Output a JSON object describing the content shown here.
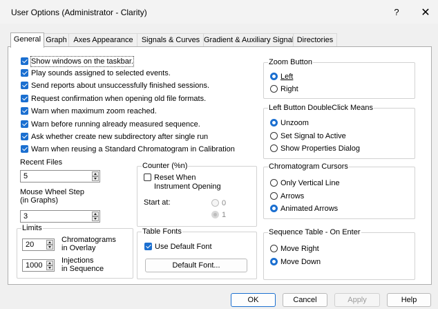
{
  "window": {
    "title": "User Options (Administrator - Clarity)",
    "help": "?",
    "close": "✕"
  },
  "tabs": [
    "General",
    "Graph",
    "Axes Appearance",
    "Signals & Curves",
    "Gradient & Auxiliary Signals",
    "Directories"
  ],
  "checkboxes": [
    {
      "label": "Show windows on the taskbar.",
      "checked": true
    },
    {
      "label": "Play sounds assigned to selected events.",
      "checked": true
    },
    {
      "label": "Send reports about unsuccessfully finished sessions.",
      "checked": true
    },
    {
      "label": "Request confirmation when opening old file formats.",
      "checked": true
    },
    {
      "label": "Warn when maximum zoom reached.",
      "checked": true
    },
    {
      "label": "Warn before running already measured sequence.",
      "checked": true
    },
    {
      "label": "Ask whether create new subdirectory after single run",
      "checked": true
    },
    {
      "label": "Warn when reusing a Standard Chromatogram in Calibration",
      "checked": true
    }
  ],
  "recent_files": {
    "label": "Recent Files",
    "value": "5"
  },
  "mouse_wheel": {
    "label_1": "Mouse Wheel Step",
    "label_2": "(in Graphs)",
    "value": "3"
  },
  "limits": {
    "title": "Limits",
    "chromatograms": {
      "value": "20",
      "label_1": "Chromatograms",
      "label_2": "in Overlay"
    },
    "injections": {
      "value": "1000",
      "label_1": "Injections",
      "label_2": "in Sequence"
    }
  },
  "counter": {
    "title": "Counter (%n)",
    "reset_label_1": "Reset When",
    "reset_label_2": "Instrument Opening",
    "reset_checked": false,
    "start_at_label": "Start at:",
    "options": [
      "0",
      "1"
    ],
    "selected": "1"
  },
  "table_fonts": {
    "title": "Table Fonts",
    "use_default_label": "Use Default Font",
    "use_default_checked": true,
    "button": "Default Font..."
  },
  "zoom_button": {
    "title": "Zoom Button",
    "options": [
      "Left",
      "Right"
    ],
    "selected": "Left"
  },
  "left_dblclick": {
    "title": "Left Button DoubleClick Means",
    "options": [
      "Unzoom",
      "Set Signal to Active",
      "Show Properties Dialog"
    ],
    "selected": "Unzoom"
  },
  "cursors": {
    "title": "Chromatogram Cursors",
    "options": [
      "Only Vertical Line",
      "Arrows",
      "Animated Arrows"
    ],
    "selected": "Animated Arrows"
  },
  "sequence_enter": {
    "title": "Sequence Table - On Enter",
    "options": [
      "Move Right",
      "Move Down"
    ],
    "selected": "Move Down"
  },
  "buttons": {
    "ok": "OK",
    "cancel": "Cancel",
    "apply": "Apply",
    "help": "Help"
  },
  "colors": {
    "accent": "#1b6fd0",
    "panel": "#ffffff",
    "window": "#f0f0f0"
  }
}
